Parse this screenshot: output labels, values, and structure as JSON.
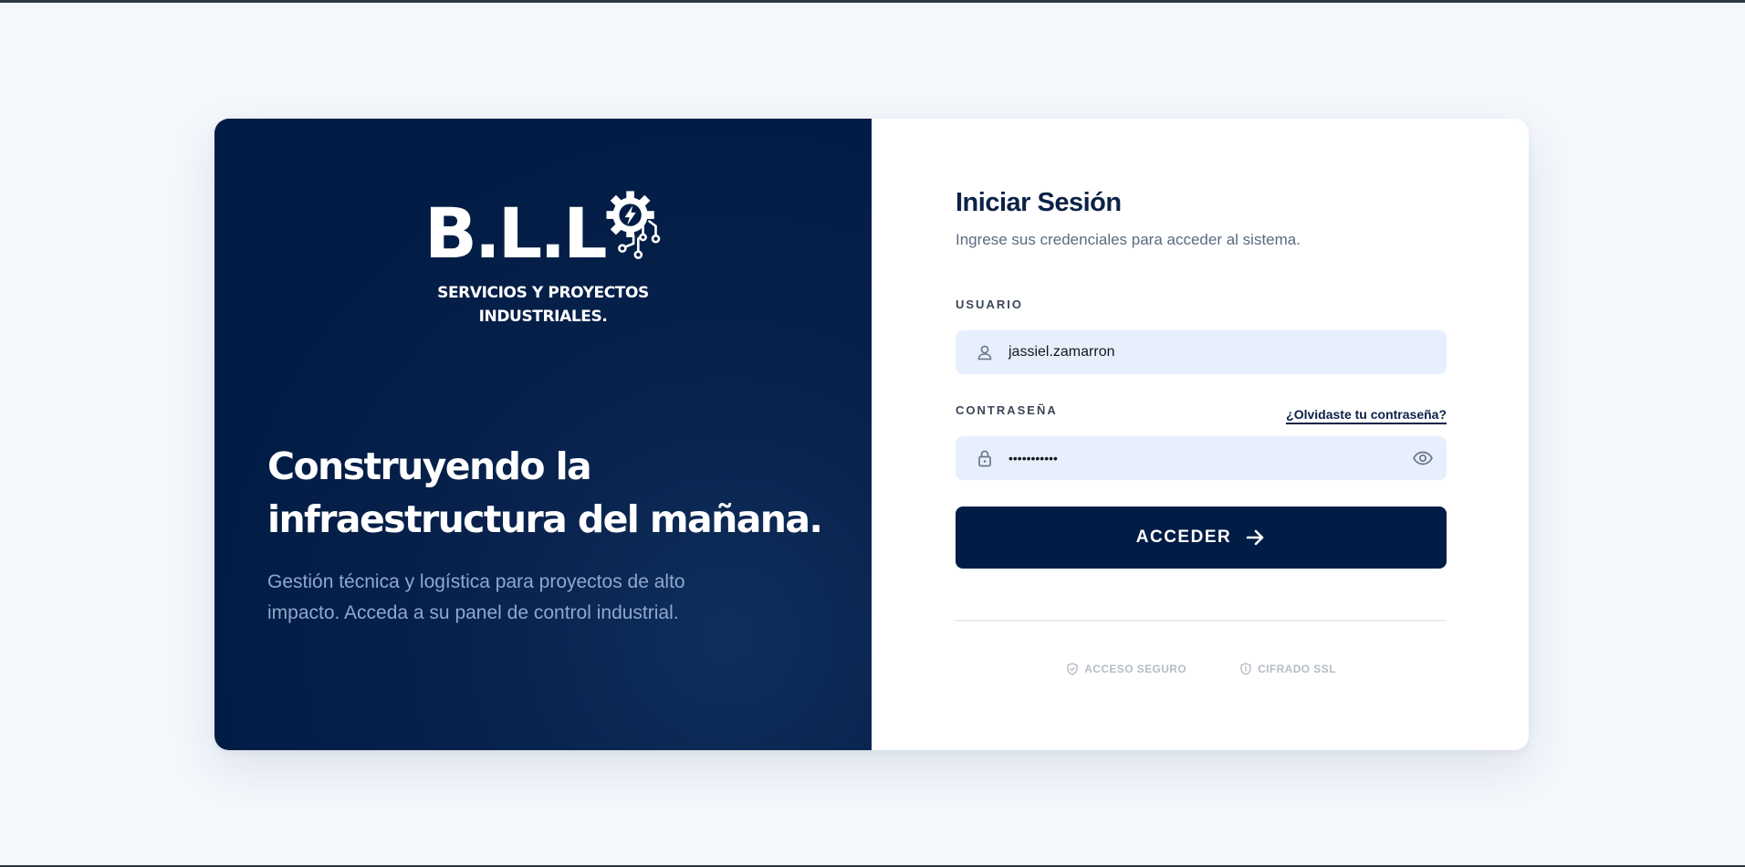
{
  "brand": {
    "logo_letters": "B.L.L",
    "tagline_line1": "SERVICIOS Y PROYECTOS",
    "tagline_line2": "INDUSTRIALES."
  },
  "hero": {
    "title": "Construyendo la\ninfraestructura del mañana.",
    "description": "Gestión técnica y logística para proyectos de alto impacto. Acceda a su panel de control industrial."
  },
  "login": {
    "title": "Iniciar Sesión",
    "subtitle": "Ingrese sus credenciales para acceder al sistema.",
    "username_label": "USUARIO",
    "username_value": "jassiel.zamarron",
    "password_label": "CONTRASEÑA",
    "password_value": "•••••••••••",
    "forgot_link": "¿Olvidaste tu contraseña?",
    "submit_label": "ACCEDER"
  },
  "security_badges": [
    {
      "icon": "shield-check-icon",
      "label": "ACCESO SEGURO"
    },
    {
      "icon": "shield-icon",
      "label": "CIFRADO SSL"
    }
  ],
  "colors": {
    "navy": "#021d45",
    "page_bg": "#f4f8fd",
    "input_bg": "#e7effc",
    "hero_desc": "#8fa8cf"
  }
}
